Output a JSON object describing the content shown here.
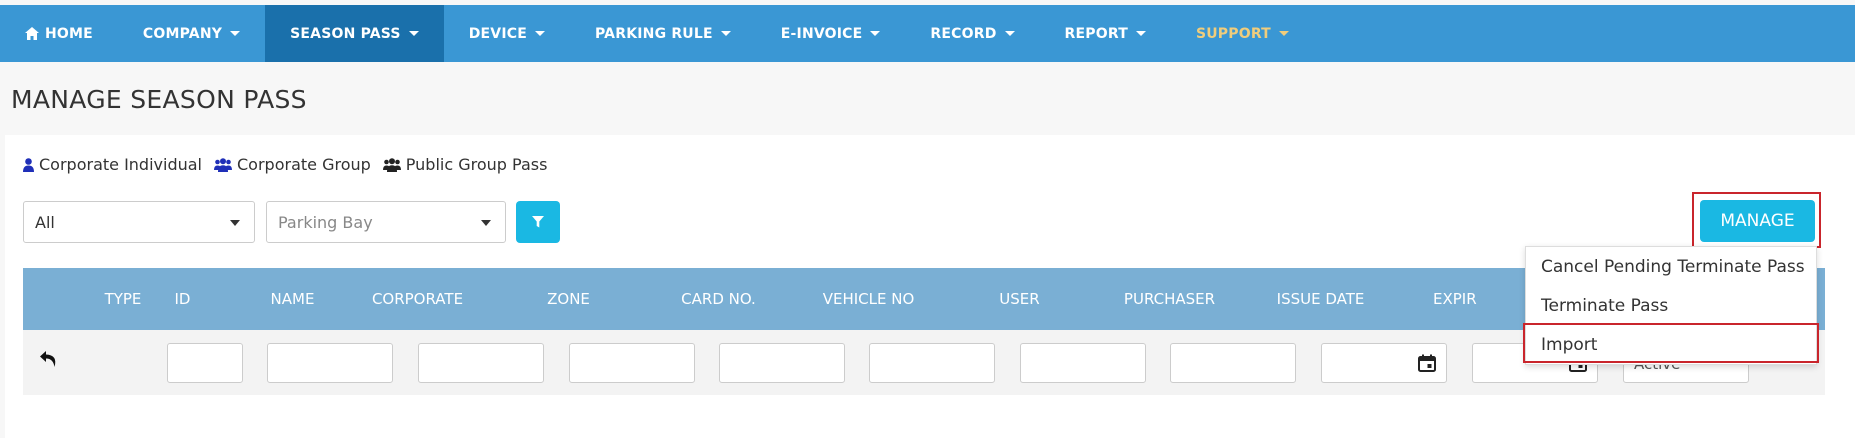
{
  "nav": {
    "items": [
      {
        "label": "HOME",
        "icon": "home-icon"
      },
      {
        "label": "COMPANY"
      },
      {
        "label": "SEASON PASS",
        "active": true
      },
      {
        "label": "DEVICE"
      },
      {
        "label": "PARKING RULE"
      },
      {
        "label": "E-INVOICE"
      },
      {
        "label": "RECORD"
      },
      {
        "label": "REPORT"
      },
      {
        "label": "SUPPORT"
      }
    ]
  },
  "page": {
    "title": "MANAGE SEASON PASS"
  },
  "legend": {
    "corporate_individual": "Corporate Individual",
    "corporate_group": "Corporate Group",
    "public_group": "Public Group Pass"
  },
  "filters": {
    "type_value": "All",
    "bay_placeholder": "Parking Bay"
  },
  "table": {
    "headers": [
      "TYPE",
      "ID",
      "NAME",
      "CORPORATE",
      "ZONE",
      "CARD NO.",
      "VEHICLE NO",
      "USER",
      "PURCHASER",
      "ISSUE DATE",
      "EXPIR"
    ],
    "status_filter_value": "Active"
  },
  "manage": {
    "button_label": "MANAGE",
    "menu": [
      "Cancel Pending Terminate Pass",
      "Terminate Pass",
      "Import"
    ]
  },
  "colors": {
    "navbar": "#3a97d4",
    "nav_active": "#1a70ab",
    "support_text": "#f0cd7c",
    "table_header": "#7aafd4",
    "accent_button": "#1ab8e3",
    "highlight_outline": "#c9252c",
    "legend_icon": "#1f2fb8"
  }
}
